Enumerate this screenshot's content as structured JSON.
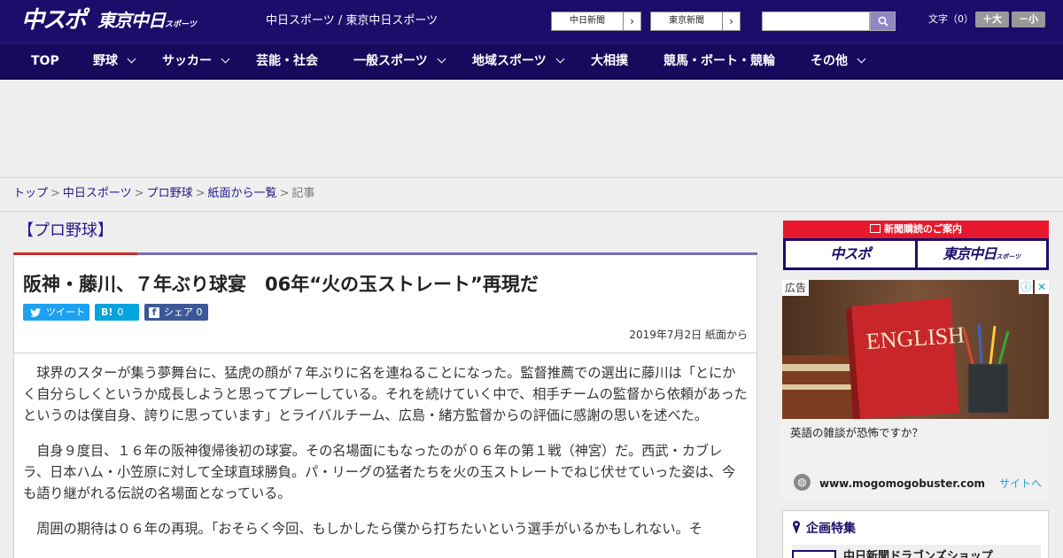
{
  "header": {
    "logo_chunichi": "中スポ",
    "logo_tokyo": "東京中日",
    "logo_tokyo_suffix": "スポーツ",
    "site_links": "中日スポーツ / 東京中日スポーツ",
    "btn_chunichi": "中日新聞",
    "btn_tokyo": "東京新聞",
    "font_size_label": "文字（0）",
    "font_plus": "＋大",
    "font_minus": "－小"
  },
  "nav": [
    {
      "label": "TOP"
    },
    {
      "label": "野球"
    },
    {
      "label": "サッカー"
    },
    {
      "label": "芸能・社会"
    },
    {
      "label": "一般スポーツ"
    },
    {
      "label": "地域スポーツ"
    },
    {
      "label": "大相撲"
    },
    {
      "label": "競馬・ボート・競輪"
    },
    {
      "label": "その他"
    }
  ],
  "breadcrumb": {
    "items": [
      "トップ",
      "中日スポーツ",
      "プロ野球",
      "紙面から一覧"
    ],
    "current": "記事"
  },
  "article": {
    "category": "【プロ野球】",
    "title": "阪神・藤川、７年ぶり球宴　06年“火の玉ストレート”再現だ",
    "share_tweet": "ツイート",
    "share_hatena_count": "0",
    "share_facebook": "シェア",
    "share_facebook_count": "0",
    "date": "2019年7月2日 紙面から",
    "paragraphs": [
      "球界のスターが集う夢舞台に、猛虎の顔が７年ぶりに名を連ねることになった。監督推薦での選出に藤川は「とにかく自分らしくというか成長しようと思ってプレーしている。それを続けていく中で、相手チームの監督から依頼があったというのは僕自身、誇りに思っています」とライバルチーム、広島・緒方監督からの評価に感謝の思いを述べた。",
      "自身９度目、１６年の阪神復帰後初の球宴。その名場面にもなったのが０６年の第１戦（神宮）だ。西武・カブレラ、日本ハム・小笠原に対して全球直球勝負。パ・リーグの猛者たちを火の玉ストレートでねじ伏せていった姿は、今も語り継がれる伝説の名場面となっている。",
      "周囲の期待は０６年の再現。「おそらく今回、もしかしたら僕から打ちたいという選手がいるかもしれない。そ"
    ]
  },
  "sidebar": {
    "subscribe_title": "新聞購読のご案内",
    "logo_chunichi": "中スポ",
    "logo_tokyo": "東京中日",
    "logo_tokyo_suffix": "スポーツ",
    "ad_label": "広告",
    "ad_book_text": "ENGLISH",
    "ad_text": "英語の雑談が恐怖ですか？",
    "ad_domain": "www.mogomogobuster.com",
    "ad_site_link": "サイトへ",
    "feature_title": "企画特集",
    "feature_item": "中日新聞ドラゴンズショップ"
  },
  "colors": {
    "header_bg": "#1c0d6b",
    "nav_bg": "#150a5c",
    "accent_red": "#d32a2a",
    "link": "#24198a",
    "twitter": "#1da1f2",
    "hatena": "#00a4de",
    "facebook": "#3b5998"
  }
}
